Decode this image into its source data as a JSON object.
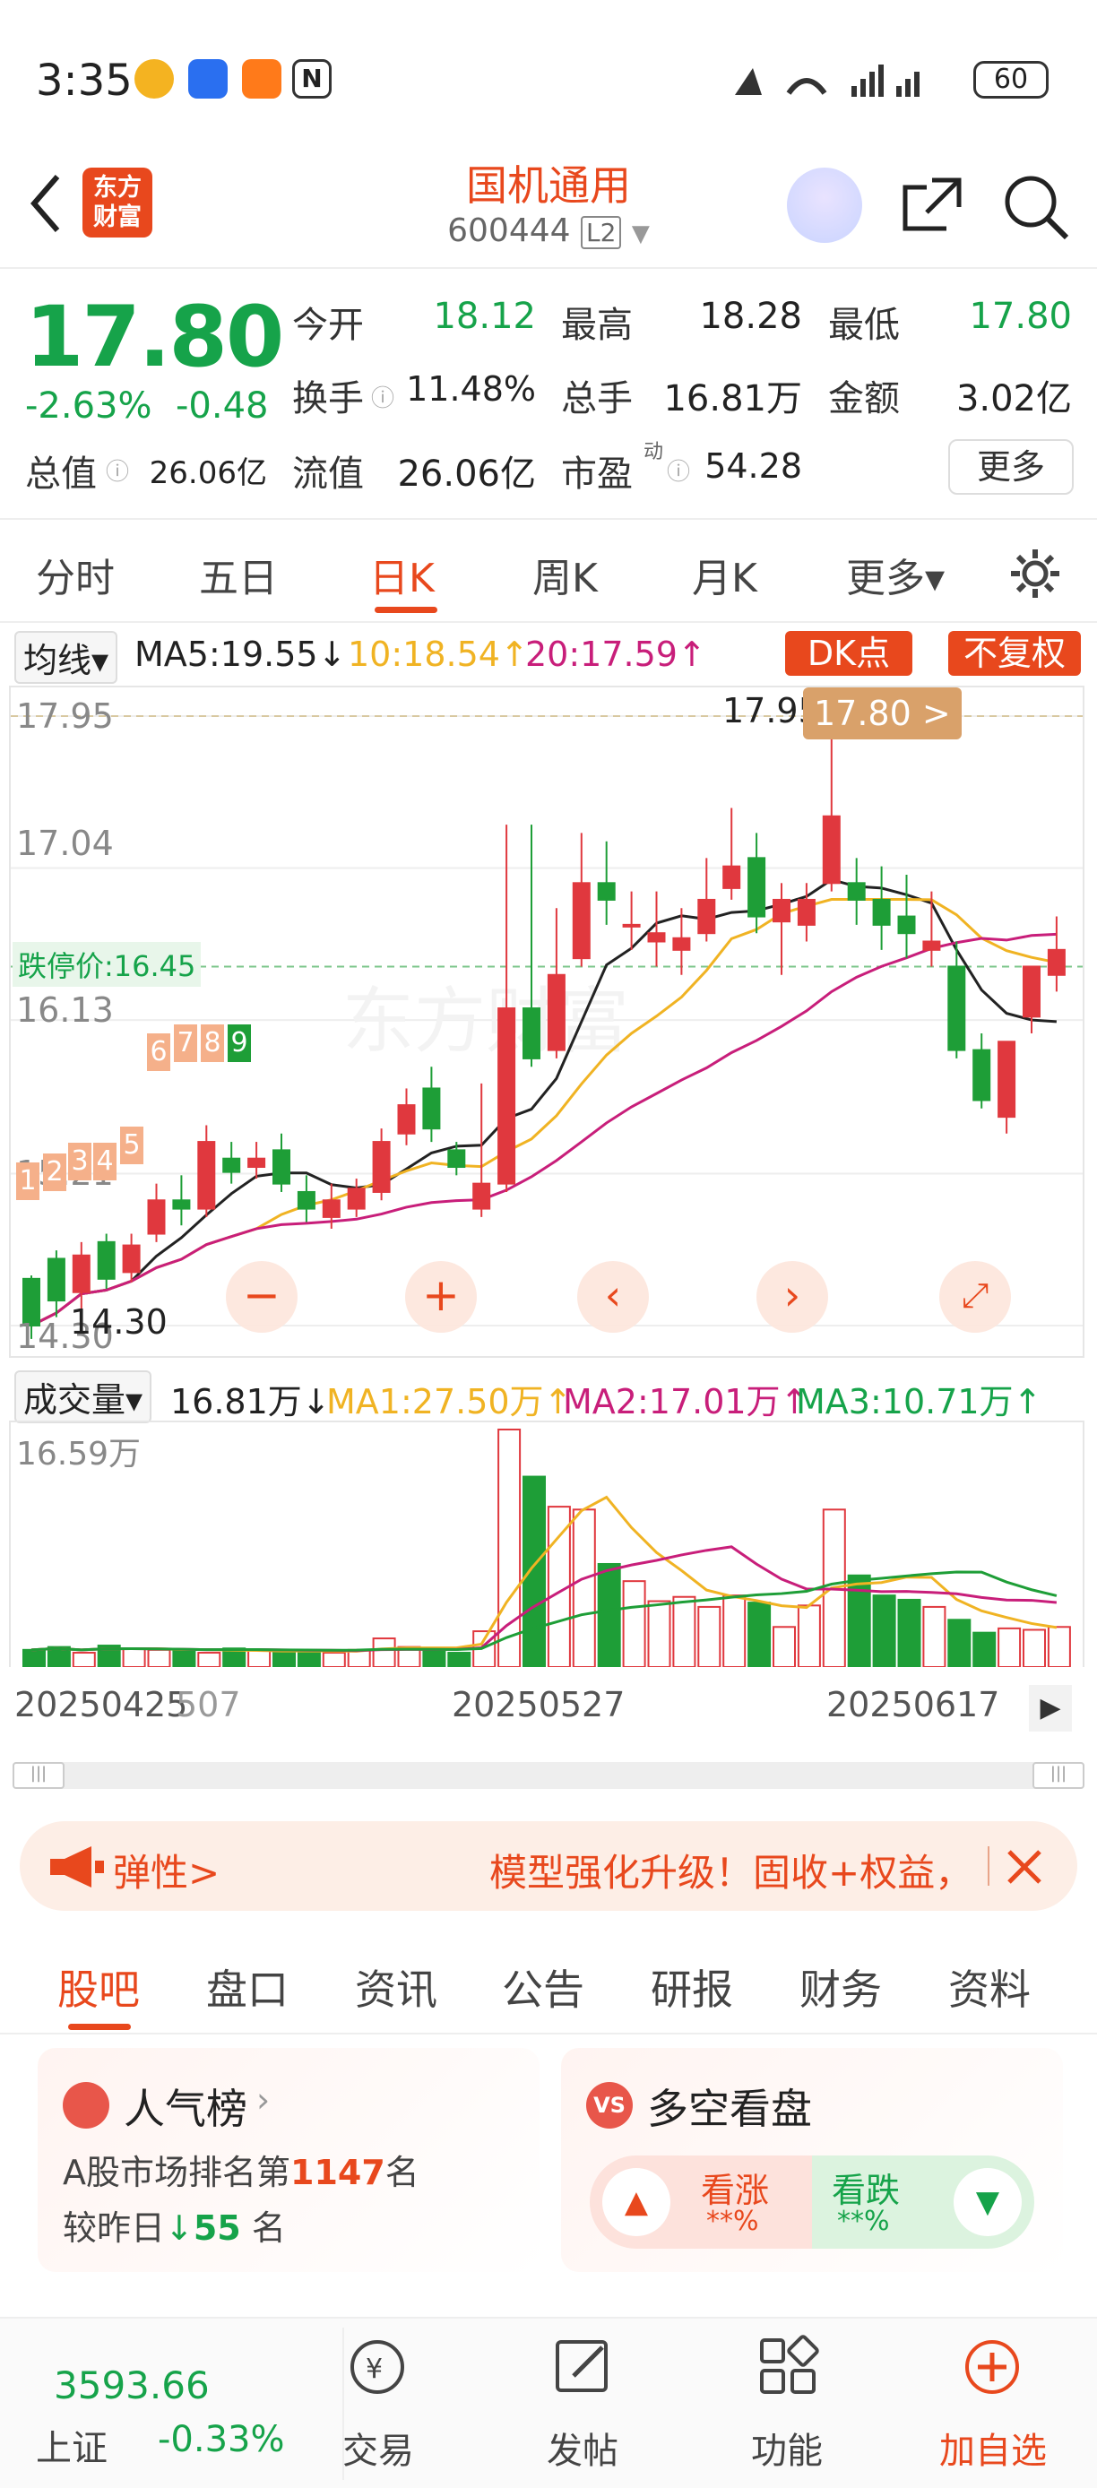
{
  "status": {
    "time": "3:35",
    "battery": "60"
  },
  "header": {
    "title": "国机通用",
    "code": "600444",
    "level": "L2",
    "logo_line1": "东方",
    "logo_line2": "财富"
  },
  "quote": {
    "price": "17.80",
    "change_pct": "-2.63%",
    "change_amt": "-0.48",
    "open_label": "今开",
    "open": "18.12",
    "high_label": "最高",
    "high": "18.28",
    "low_label": "最低",
    "low": "17.80",
    "turnover_label": "换手",
    "turnover": "11.48%",
    "volume_label": "总手",
    "volume": "16.81万",
    "amount_label": "金额",
    "amount": "3.02亿",
    "mktcap_label": "总值",
    "mktcap": "26.06亿",
    "float_label": "流值",
    "float": "26.06亿",
    "pe_label": "市盈",
    "pe_sup": "动",
    "pe": "54.28",
    "more": "更多"
  },
  "tabs": [
    "分时",
    "五日",
    "日K",
    "周K",
    "月K",
    "更多▾"
  ],
  "active_tab": "日K",
  "ma_bar": {
    "selector": "均线▾",
    "ma5": "MA5:19.55↓",
    "ma10": "10:18.54↑",
    "ma20": "20:17.59↑",
    "dk": "DK点",
    "fq": "不复权"
  },
  "kline": {
    "y_labels": [
      "17.95",
      "17.04",
      "16.13",
      "15.21",
      "14.30"
    ],
    "limit_down": "跌停价:16.45",
    "high_mark": "17.95",
    "price_tag": "17.80 >",
    "low_mark": "14.30",
    "markers": [
      "1",
      "2",
      "3",
      "4",
      "5",
      "6",
      "7",
      "8",
      "9"
    ],
    "watermark": "东方财富"
  },
  "vol_bar": {
    "selector": "成交量▾",
    "vol": "16.81万↓",
    "ma1": "MA1:27.50万↑",
    "ma2": "MA2:17.01万↑",
    "ma3": "MA3:10.71万↑",
    "max_label": "16.59万"
  },
  "dates": [
    "20250425",
    "507",
    "20250527",
    "20250617"
  ],
  "banner": {
    "left_text": "弹性>",
    "main_text": "模型强化升级！固收+权益，"
  },
  "subtabs": [
    "股吧",
    "盘口",
    "资讯",
    "公告",
    "研报",
    "财务",
    "资料"
  ],
  "popularity": {
    "title": "人气榜",
    "rank_prefix": "A股市场排名第",
    "rank": "1147",
    "rank_suffix": "名",
    "diff_prefix": "较昨日",
    "diff": "55",
    "diff_suffix": " 名"
  },
  "vote": {
    "title": "多空看盘",
    "up_label": "看涨",
    "up_pct": "**%",
    "down_label": "看跌",
    "down_pct": "**%"
  },
  "index": {
    "value": "3593.66",
    "name": "上证",
    "pct": "-0.33%"
  },
  "bottom_nav": [
    "交易",
    "发帖",
    "功能",
    "加自选"
  ],
  "chart_data": {
    "type": "candlestick",
    "ylim": [
      14.3,
      17.95
    ],
    "limit_down_price": 16.45,
    "candles": [
      [
        14.58,
        14.3,
        14.22,
        14.6
      ],
      [
        14.7,
        14.45,
        14.35,
        14.75
      ],
      [
        14.5,
        14.72,
        14.4,
        14.8
      ],
      [
        14.8,
        14.58,
        14.52,
        14.85
      ],
      [
        14.62,
        14.78,
        14.56,
        14.85
      ],
      [
        14.85,
        15.05,
        14.8,
        15.15
      ],
      [
        15.05,
        15.0,
        14.9,
        15.2
      ],
      [
        15.0,
        15.4,
        14.95,
        15.5
      ],
      [
        15.3,
        15.22,
        15.15,
        15.4
      ],
      [
        15.25,
        15.3,
        15.18,
        15.4
      ],
      [
        15.35,
        15.15,
        15.1,
        15.45
      ],
      [
        15.1,
        15.0,
        14.92,
        15.2
      ],
      [
        14.95,
        15.05,
        14.88,
        15.15
      ],
      [
        15.0,
        15.12,
        14.95,
        15.18
      ],
      [
        15.1,
        15.4,
        15.05,
        15.48
      ],
      [
        15.45,
        15.62,
        15.38,
        15.72
      ],
      [
        15.72,
        15.48,
        15.4,
        15.85
      ],
      [
        15.35,
        15.25,
        15.2,
        15.4
      ],
      [
        15.0,
        15.15,
        14.95,
        15.75
      ],
      [
        15.15,
        16.2,
        15.1,
        17.3
      ],
      [
        16.2,
        15.9,
        15.85,
        17.3
      ],
      [
        15.95,
        16.4,
        15.9,
        16.8
      ],
      [
        16.5,
        16.95,
        16.45,
        17.25
      ],
      [
        16.95,
        16.85,
        16.7,
        17.2
      ],
      [
        16.7,
        16.7,
        16.55,
        16.9
      ],
      [
        16.6,
        16.65,
        16.45,
        16.9
      ],
      [
        16.55,
        16.62,
        16.4,
        16.8
      ],
      [
        16.65,
        16.85,
        16.6,
        17.1
      ],
      [
        16.92,
        17.05,
        16.85,
        17.4
      ],
      [
        17.1,
        16.75,
        16.65,
        17.25
      ],
      [
        16.72,
        16.85,
        16.4,
        16.95
      ],
      [
        16.7,
        16.85,
        16.6,
        16.95
      ],
      [
        16.95,
        17.35,
        16.9,
        17.95
      ],
      [
        16.95,
        16.85,
        16.7,
        17.1
      ],
      [
        16.85,
        16.7,
        16.55,
        17.05
      ],
      [
        16.75,
        16.65,
        16.5,
        17.0
      ],
      [
        16.55,
        16.6,
        16.45,
        16.9
      ],
      [
        16.45,
        15.95,
        15.9,
        16.6
      ],
      [
        15.95,
        15.65,
        15.6,
        16.05
      ],
      [
        15.55,
        16.0,
        15.45,
        16.0
      ],
      [
        16.15,
        16.45,
        16.05,
        16.45
      ],
      [
        16.4,
        16.55,
        16.3,
        16.75
      ]
    ],
    "volumes": [
      1.2,
      1.4,
      1.0,
      1.5,
      1.3,
      1.2,
      1.1,
      1.0,
      1.3,
      1.2,
      1.0,
      1.1,
      1.0,
      1.2,
      2.0,
      1.4,
      1.1,
      1.0,
      2.5,
      16.59,
      13.3,
      11.2,
      11.0,
      7.2,
      6.0,
      4.6,
      4.9,
      4.2,
      5.0,
      4.5,
      2.8,
      4.3,
      11.0,
      6.4,
      5.0,
      4.7,
      4.2,
      3.3,
      2.4,
      2.7,
      2.6,
      2.8
    ]
  }
}
